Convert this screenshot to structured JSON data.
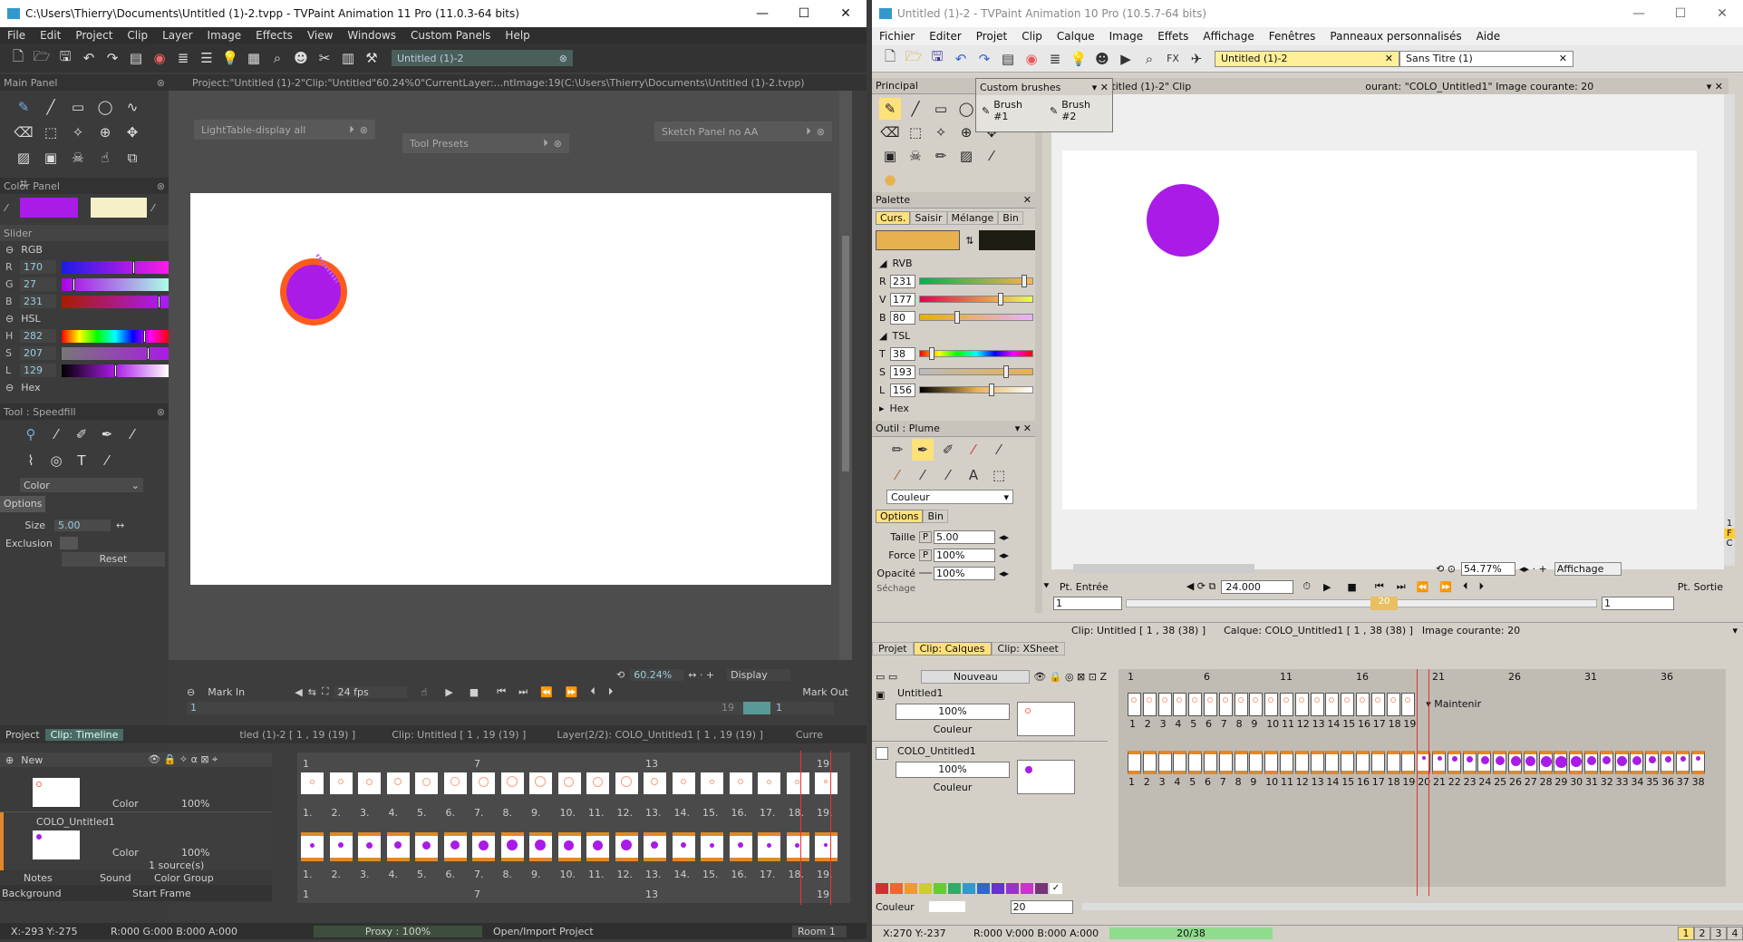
{
  "left": {
    "title": "C:\\Users\\Thierry\\Documents\\Untitled (1)-2.tvpp - TVPaint Animation 11 Pro (11.0.3-64 bits)",
    "menu": [
      "File",
      "Edit",
      "Project",
      "Clip",
      "Layer",
      "Image",
      "Effects",
      "View",
      "Windows",
      "Custom Panels",
      "Help"
    ],
    "doc_tab": "Untitled (1)-2",
    "main_panel": "Main Panel",
    "project_info": "Project:\"Untitled (1)-2\"Clip:\"Untitled\"60.24%0\"CurrentLayer:...ntImage:19(C:\\Users\\Thierry\\Documents\\Untitled (1)-2.tvpp)",
    "lighttable": "LightTable-display all",
    "tool_presets": "Tool Presets",
    "sketch_panel": "Sketch Panel no AA",
    "color_panel": "Color Panel",
    "slider_label": "Slider",
    "rgb_label": "RGB",
    "hsl_label": "HSL",
    "hex_label": "Hex",
    "rgb": [
      {
        "l": "R",
        "v": "170"
      },
      {
        "l": "G",
        "v": "27"
      },
      {
        "l": "B",
        "v": "231"
      }
    ],
    "hsl": [
      {
        "l": "H",
        "v": "282"
      },
      {
        "l": "S",
        "v": "207"
      },
      {
        "l": "L",
        "v": "129"
      }
    ],
    "tool_panel": "Tool : Speedfill",
    "tool_mode": "Color",
    "options_tab": "Options",
    "size_label": "Size",
    "size_val": "5.00",
    "exclusion_label": "Exclusion",
    "reset_label": "Reset",
    "zoom": "60.24%",
    "display": "Display",
    "mark_in": "Mark In",
    "mark_out": "Mark Out",
    "fps": "24 fps",
    "in_val": "1",
    "out_val": "1",
    "tl_frame_19": "19",
    "tabs": [
      "Project",
      "Clip: Timeline"
    ],
    "tl_info1": "tled (1)-2 [ 1 , 19  (19) ]",
    "tl_info2": "Clip: Untitled [ 1 , 19  (19) ]",
    "tl_info3": "Layer(2/2): COLO_Untitled1 [ 1 , 19  (19) ]",
    "tl_info4": "Curre",
    "new_label": "New",
    "layer1_mode": "Color",
    "layer1_op": "100%",
    "layer2_name": "COLO_Untitled1",
    "layer2_mode": "Color",
    "layer2_op": "100%",
    "sources": "1 source(s)",
    "notes": "Notes",
    "sound": "Sound",
    "color_group": "Color Group",
    "background": "Background",
    "start_frame": "Start Frame",
    "ruler": [
      "1",
      "7",
      "13",
      "19"
    ],
    "frames": [
      "1.",
      "2.",
      "3.",
      "4.",
      "5.",
      "6.",
      "7.",
      "8.",
      "9.",
      "10.",
      "11.",
      "12.",
      "13.",
      "14.",
      "15.",
      "16.",
      "17.",
      "18.",
      "19."
    ],
    "status_xy": "X:-293  Y:-275",
    "status_rgba": "R:000 G:000 B:000 A:000",
    "status_proxy": "Proxy : 100%",
    "status_open": "Open/Import Project",
    "status_room": "Room 1",
    "fg_color": "#aa1be7",
    "bg_color": "#f5f0c8"
  },
  "right": {
    "title": "Untitled (1)-2 - TVPaint Animation 10 Pro (10.5.7-64 bits)",
    "menu": [
      "Fichier",
      "Editer",
      "Projet",
      "Clip",
      "Calque",
      "Image",
      "Effets",
      "Affichage",
      "Fenêtres",
      "Panneaux personnalisés",
      "Aide"
    ],
    "doc_tab": "Untitled (1)-2",
    "doc_tab2": "Sans Titre (1)",
    "principal": "Principal",
    "proj_info": "Projet:  \"Untitled (1)-2\"  Clip",
    "proj_info2": "ourant: \"COLO_Untitled1\"  Image courante: 20",
    "custom_brushes": "Custom brushes",
    "brush1": "Brush #1",
    "brush2": "Brush #2",
    "palette": "Palette",
    "palette_tabs": [
      "Curs.",
      "Saisir",
      "Mélange",
      "Bin"
    ],
    "rvb_label": "RVB",
    "tsl_label": "TSL",
    "hex_label": "Hex",
    "rvb": [
      {
        "l": "R",
        "v": "231"
      },
      {
        "l": "V",
        "v": "177"
      },
      {
        "l": "B",
        "v": "80"
      }
    ],
    "tsl": [
      {
        "l": "T",
        "v": "38"
      },
      {
        "l": "S",
        "v": "193"
      },
      {
        "l": "L",
        "v": "156"
      }
    ],
    "tool": "Outil : Plume",
    "mode": "Couleur",
    "options_tabs": [
      "Options",
      "Bin"
    ],
    "taille_label": "Taille",
    "taille": "5.00",
    "force_label": "Force",
    "force": "100%",
    "opacite_label": "Opacité",
    "opacite": "100%",
    "sechage_label": "Séchage",
    "zoom": "54.77%",
    "affichage": "Affichage",
    "pt_entree": "Pt. Entrée",
    "pt_sortie": "Pt. Sortie",
    "fps": "24.000",
    "in_val": "1",
    "out_val": "1",
    "cursor_frame": "20",
    "clip_info": "Clip: Untitled [ 1 , 38  (38) ]",
    "layer_info": "Calque: COLO_Untitled1 [ 1 , 38  (38) ]",
    "image_info": "Image courante: 20",
    "tl_tabs": [
      "Projet",
      "Clip: Calques",
      "Clip: XSheet"
    ],
    "nouveau": "Nouveau",
    "layer1": "Untitled1",
    "layer1_op": "100%",
    "layer1_mode": "Couleur",
    "layer2": "COLO_Untitled1",
    "layer2_op": "100%",
    "layer2_mode": "Couleur",
    "maintenir": "Maintenir",
    "ruler": [
      "1",
      "6",
      "11",
      "16",
      "21",
      "26",
      "31",
      "36"
    ],
    "bottom_mode": "Couleur",
    "bottom_val": "20",
    "status_xy": "X:270  Y:-237",
    "status_rgba": "R:000 V:000 B:000 A:000",
    "status_frames": "20/38",
    "pages": [
      "1",
      "2",
      "3",
      "4"
    ],
    "fg_color": "#e7b150",
    "bg_color": "#1d1d12"
  }
}
